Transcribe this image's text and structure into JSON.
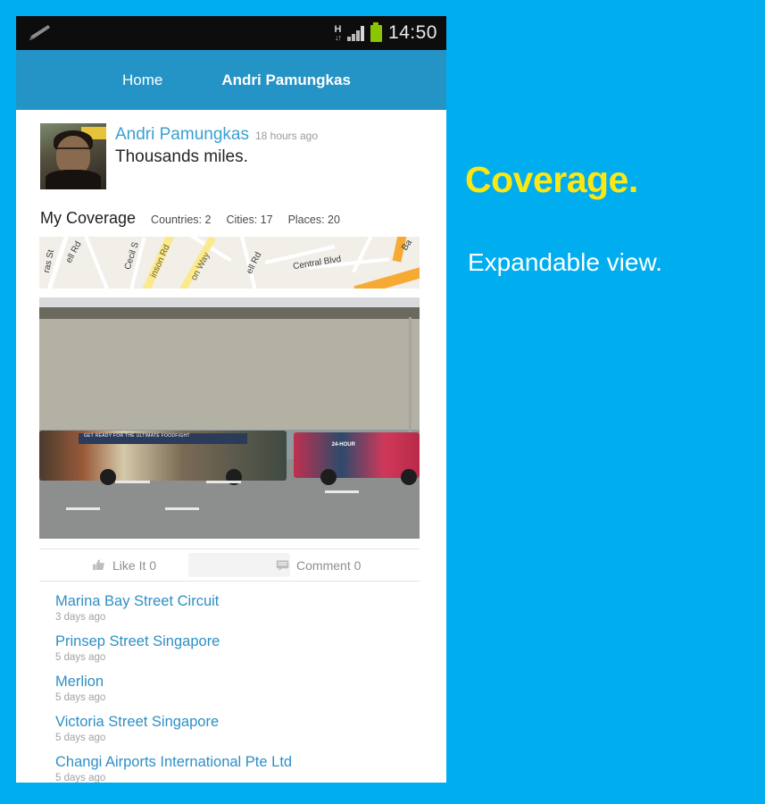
{
  "statusbar": {
    "edit_icon": "pencil-icon",
    "network_label": "H",
    "network_arrows": "↓↑",
    "signal_icon": "signal-bars-icon",
    "battery_icon": "battery-icon",
    "time": "14:50"
  },
  "tabs": [
    {
      "label": "Home",
      "active": false
    },
    {
      "label": "Andri Pamungkas",
      "active": true
    }
  ],
  "post": {
    "avatar": "user-avatar",
    "author": "Andri Pamungkas",
    "time": "18 hours ago",
    "text": "Thousands miles."
  },
  "coverage": {
    "title": "My Coverage",
    "stats": [
      "Countries: 2",
      "Cities: 17",
      "Places: 20"
    ]
  },
  "map": {
    "labels": [
      "ras St",
      "ell Rd",
      "Cecil S",
      "inson Rd",
      "on Way",
      "ell Rd",
      "Central Blvd",
      "Ba"
    ]
  },
  "photo": {
    "caption": "two city buses parked in front of an arched stone building",
    "bus1_ad_text": "GET READY FOR THE ULTIMATE FOODFIGHT",
    "bus2_ad_text": "24-HOUR"
  },
  "actions": {
    "like": {
      "icon": "thumbs-up-icon",
      "label": "Like It 0"
    },
    "comment": {
      "icon": "comment-bubble-icon",
      "label": "Comment 0"
    }
  },
  "places": [
    {
      "name": "Marina Bay Street Circuit",
      "time": "3 days ago"
    },
    {
      "name": "Prinsep Street Singapore",
      "time": "5 days ago"
    },
    {
      "name": "Merlion",
      "time": "5 days ago"
    },
    {
      "name": "Victoria Street Singapore",
      "time": "5 days ago"
    },
    {
      "name": "Changi Airports International Pte Ltd",
      "time": "5 days ago"
    }
  ],
  "promo": {
    "title": "Coverage.",
    "subtitle": "Expandable view."
  },
  "colors": {
    "page_background": "#00aeef",
    "app_bar": "#2494c6",
    "status_bar": "#0d0d0d",
    "link_blue": "#2f8fc4",
    "promo_yellow": "#fbe713",
    "battery_green": "#8bc400"
  }
}
